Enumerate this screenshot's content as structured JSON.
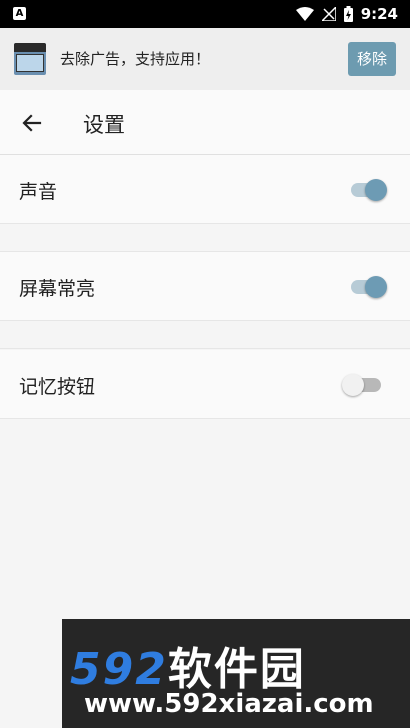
{
  "status_bar": {
    "notification_icon_letter": "A",
    "time": "9:24"
  },
  "ad": {
    "text": "去除广告，支持应用！",
    "button": "移除"
  },
  "app_bar": {
    "title": "设置"
  },
  "settings": [
    {
      "label": "声音",
      "enabled": true
    },
    {
      "label": "屏幕常亮",
      "enabled": true
    },
    {
      "label": "记忆按钮",
      "enabled": false
    }
  ],
  "watermark": {
    "brand_number": "592",
    "brand_text": "软件园",
    "url": "www.592xiazai.com"
  },
  "colors": {
    "accent": "#6d9bb4",
    "ad_button": "#6d9bb0"
  }
}
